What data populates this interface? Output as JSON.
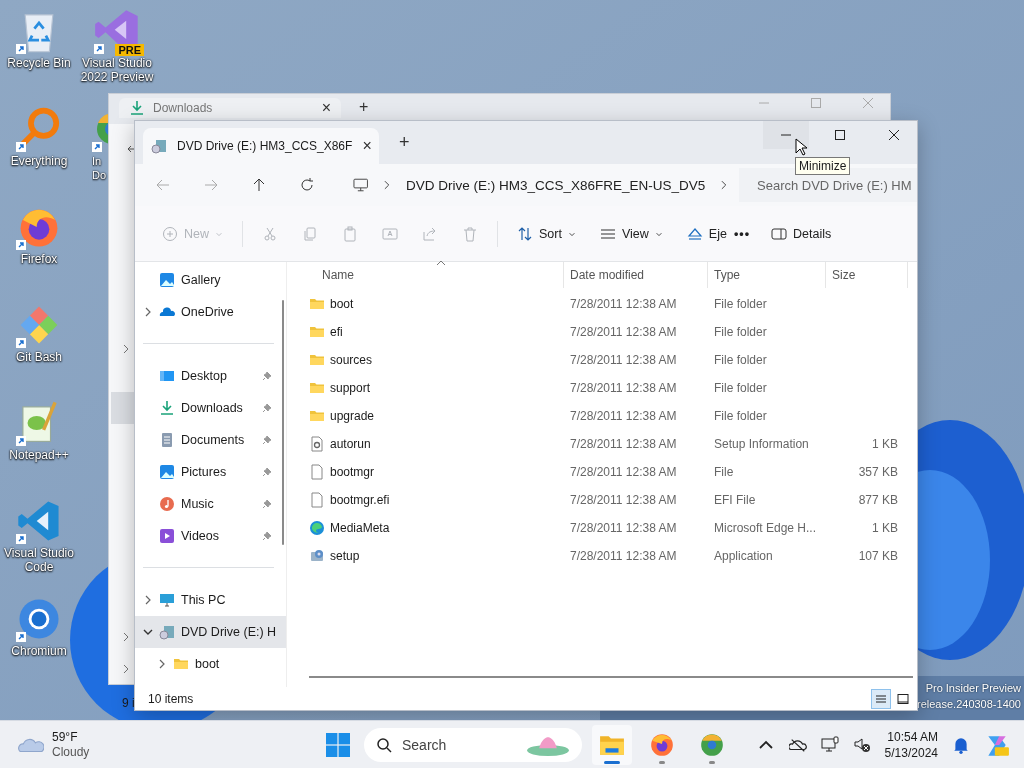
{
  "desktop": {
    "icons": [
      {
        "label": "Recycle Bin",
        "kind": "recycle"
      },
      {
        "label": "Everything",
        "kind": "everything"
      },
      {
        "label": "Firefox",
        "kind": "firefox"
      },
      {
        "label": "Git Bash",
        "kind": "git"
      },
      {
        "label": "Notepad++",
        "kind": "notepad"
      },
      {
        "label": "Visual Studio Code",
        "kind": "vscode"
      },
      {
        "label": "Chromium",
        "kind": "chromium"
      },
      {
        "label": "Visual Studio 2022 Preview",
        "kind": "vs",
        "badge": "PRE"
      },
      {
        "label": "In Do",
        "kind": "idm"
      }
    ],
    "edition_text": [
      "Pro Insider Preview",
      "release.240308-1400"
    ]
  },
  "background_window": {
    "tab": {
      "title": "Downloads",
      "close": "×"
    },
    "new_tab": "+",
    "status": "9 i"
  },
  "window": {
    "tab": {
      "title": "DVD Drive (E:) HM3_CCS_X86F",
      "close": "×"
    },
    "new_tab": "+",
    "tooltip": "Minimize",
    "breadcrumb": "DVD Drive (E:) HM3_CCS_X86FRE_EN-US_DV5",
    "search": {
      "placeholder": "Search DVD Drive (E:) HM"
    },
    "toolbar": [
      {
        "kind": "new",
        "label": "New",
        "disabled": true
      },
      {
        "kind": "cut",
        "disabled": true
      },
      {
        "kind": "copy",
        "disabled": true
      },
      {
        "kind": "paste",
        "disabled": true
      },
      {
        "kind": "rename",
        "disabled": true
      },
      {
        "kind": "share",
        "disabled": true
      },
      {
        "kind": "delete",
        "disabled": true
      },
      {
        "kind": "sort",
        "label": "Sort",
        "disabled": false
      },
      {
        "kind": "view",
        "label": "View",
        "disabled": false
      },
      {
        "kind": "eject",
        "label": "Eje",
        "disabled": false
      },
      {
        "kind": "more",
        "label": "•••",
        "disabled": false
      },
      {
        "kind": "details",
        "label": "Details",
        "disabled": false
      }
    ],
    "nav": [
      [
        {
          "label": "Gallery",
          "kind": "gallery",
          "expandable": false,
          "pinned": false,
          "selected": false
        },
        {
          "label": "OneDrive",
          "kind": "onedrive",
          "expandable": true,
          "expanded": false,
          "pinned": false,
          "selected": false
        }
      ],
      [
        {
          "label": "Desktop",
          "kind": "desktop",
          "expandable": false,
          "pinned": true,
          "selected": false
        },
        {
          "label": "Downloads",
          "kind": "downloads",
          "expandable": false,
          "pinned": true,
          "selected": false
        },
        {
          "label": "Documents",
          "kind": "documents",
          "expandable": false,
          "pinned": true,
          "selected": false
        },
        {
          "label": "Pictures",
          "kind": "pictures",
          "expandable": false,
          "pinned": true,
          "selected": false
        },
        {
          "label": "Music",
          "kind": "music",
          "expandable": false,
          "pinned": true,
          "selected": false
        },
        {
          "label": "Videos",
          "kind": "videos",
          "expandable": false,
          "pinned": true,
          "selected": false
        }
      ],
      [
        {
          "label": "This PC",
          "kind": "pc",
          "expandable": true,
          "expanded": false,
          "pinned": false,
          "selected": false
        },
        {
          "label": "DVD Drive (E:) H",
          "kind": "dvd",
          "expandable": true,
          "expanded": true,
          "pinned": false,
          "selected": true,
          "children": [
            {
              "label": "boot",
              "kind": "folder",
              "expandable": true,
              "expanded": false,
              "pinned": false,
              "selected": false
            }
          ]
        }
      ]
    ],
    "columns": [
      "Name",
      "Date modified",
      "Type",
      "Size"
    ],
    "rows": [
      {
        "name": "boot",
        "date": "7/28/2011 12:38 AM",
        "type": "File folder",
        "kind": "folder"
      },
      {
        "name": "efi",
        "date": "7/28/2011 12:38 AM",
        "type": "File folder",
        "kind": "folder"
      },
      {
        "name": "sources",
        "date": "7/28/2011 12:38 AM",
        "type": "File folder",
        "kind": "folder"
      },
      {
        "name": "support",
        "date": "7/28/2011 12:38 AM",
        "type": "File folder",
        "kind": "folder"
      },
      {
        "name": "upgrade",
        "date": "7/28/2011 12:38 AM",
        "type": "File folder",
        "kind": "folder"
      },
      {
        "name": "autorun",
        "date": "7/28/2011 12:38 AM",
        "type": "Setup Information",
        "size": "1 KB",
        "kind": "setupinfo"
      },
      {
        "name": "bootmgr",
        "date": "7/28/2011 12:38 AM",
        "type": "File",
        "size": "357 KB",
        "kind": "file"
      },
      {
        "name": "bootmgr.efi",
        "date": "7/28/2011 12:38 AM",
        "type": "EFI File",
        "size": "877 KB",
        "kind": "file"
      },
      {
        "name": "MediaMeta",
        "date": "7/28/2011 12:38 AM",
        "type": "Microsoft Edge H...",
        "size": "1 KB",
        "kind": "edge"
      },
      {
        "name": "setup",
        "date": "7/28/2011 12:38 AM",
        "type": "Application",
        "size": "107 KB",
        "kind": "app"
      }
    ],
    "status": "10 items",
    "views": [
      {
        "kind": "details",
        "selected": true
      },
      {
        "kind": "tiles",
        "selected": false
      }
    ]
  },
  "taskbar": {
    "weather": {
      "temp": "59°F",
      "condition": "Cloudy"
    },
    "search": {
      "placeholder": "Search"
    },
    "apps": [
      {
        "kind": "explorer",
        "active": true
      },
      {
        "kind": "firefox",
        "active": false
      },
      {
        "kind": "idm",
        "active": false
      }
    ],
    "time": "10:54 AM",
    "date": "5/13/2024"
  }
}
